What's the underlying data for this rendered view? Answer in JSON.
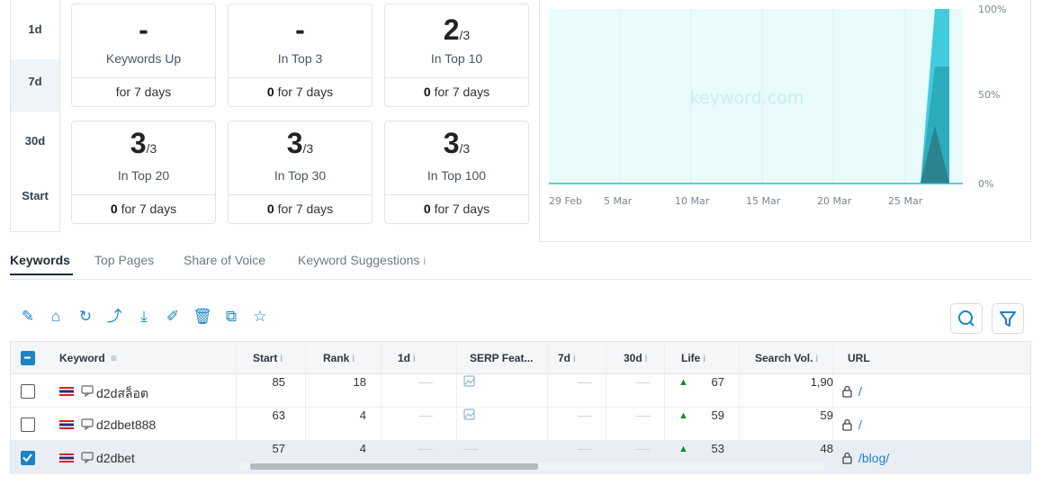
{
  "periods": [
    "1d",
    "7d",
    "30d",
    "Start"
  ],
  "cards": [
    {
      "big": "-",
      "sub": "",
      "label": "Keywords Up",
      "foot_bold": "",
      "foot_text": "for 7 days"
    },
    {
      "big": "-",
      "sub": "",
      "label": "In Top 3",
      "foot_bold": "0",
      "foot_text": " for 7 days"
    },
    {
      "big": "2",
      "sub": "/3",
      "label": "In Top 10",
      "foot_bold": "0",
      "foot_text": " for 7 days"
    },
    {
      "big": "3",
      "sub": "/3",
      "label": "In Top 20",
      "foot_bold": "0",
      "foot_text": " for 7 days"
    },
    {
      "big": "3",
      "sub": "/3",
      "label": "In Top 30",
      "foot_bold": "0",
      "foot_text": " for 7 days"
    },
    {
      "big": "3",
      "sub": "/3",
      "label": "In Top 100",
      "foot_bold": "0",
      "foot_text": " for 7 days"
    }
  ],
  "chart": {
    "watermark": "keyword.com",
    "y_ticks": [
      "100%",
      "50%",
      "0%"
    ],
    "x_ticks": [
      "29 Feb",
      "5 Mar",
      "10 Mar",
      "15 Mar",
      "20 Mar",
      "25 Mar"
    ],
    "colors": {
      "bg": "#e9fbfd",
      "top100": "#38c9dc",
      "top10": "#2aa7b8",
      "top3": "#2e7d8a"
    }
  },
  "chart_data": {
    "type": "area",
    "x": [
      "29 Feb",
      "5 Mar",
      "10 Mar",
      "15 Mar",
      "20 Mar",
      "25 Mar",
      "26 Mar",
      "27 Mar",
      "28 Mar"
    ],
    "series": [
      {
        "values": [
          0,
          0,
          0,
          0,
          0,
          0,
          0,
          100,
          100
        ]
      },
      {
        "values": [
          0,
          0,
          0,
          0,
          0,
          0,
          0,
          67,
          67
        ]
      },
      {
        "values": [
          0,
          0,
          0,
          0,
          0,
          0,
          0,
          33,
          0
        ]
      }
    ],
    "ylim": [
      0,
      100
    ]
  },
  "tabs": [
    "Keywords",
    "Top Pages",
    "Share of Voice",
    "Keyword Suggestions"
  ],
  "tab_info": "i",
  "toolbar": {
    "icons": [
      "edit-icon",
      "tag-icon",
      "refresh-icon",
      "chart-icon",
      "download-icon",
      "pen-icon",
      "trash-icon",
      "copy-icon",
      "star-icon"
    ],
    "glyphs": [
      "✎",
      "⌂",
      "↻",
      "⤴",
      "⤓",
      "✐",
      "🗑",
      "⧉",
      "☆"
    ]
  },
  "table": {
    "headers": {
      "keyword": "Keyword",
      "start": "Start",
      "rank": "Rank",
      "d1": "1d",
      "serp": "SERP Feat...",
      "d7": "7d",
      "d30": "30d",
      "life": "Life",
      "volume": "Search Vol.",
      "url": "URL"
    },
    "info": "i",
    "sort_icon": "≡",
    "rows": [
      {
        "keyword": "d2dสล็อต",
        "start": "85",
        "rank": "18",
        "life": "67",
        "volume": "1,90",
        "url": "/",
        "checked": false,
        "serp_icon": true
      },
      {
        "keyword": "d2dbet888",
        "start": "63",
        "rank": "4",
        "life": "59",
        "volume": "59",
        "url": "/",
        "checked": false,
        "serp_icon": true
      },
      {
        "keyword": "d2dbet",
        "start": "57",
        "rank": "4",
        "life": "53",
        "volume": "48",
        "url": "/blog/",
        "checked": true,
        "serp_icon": false
      }
    ]
  }
}
